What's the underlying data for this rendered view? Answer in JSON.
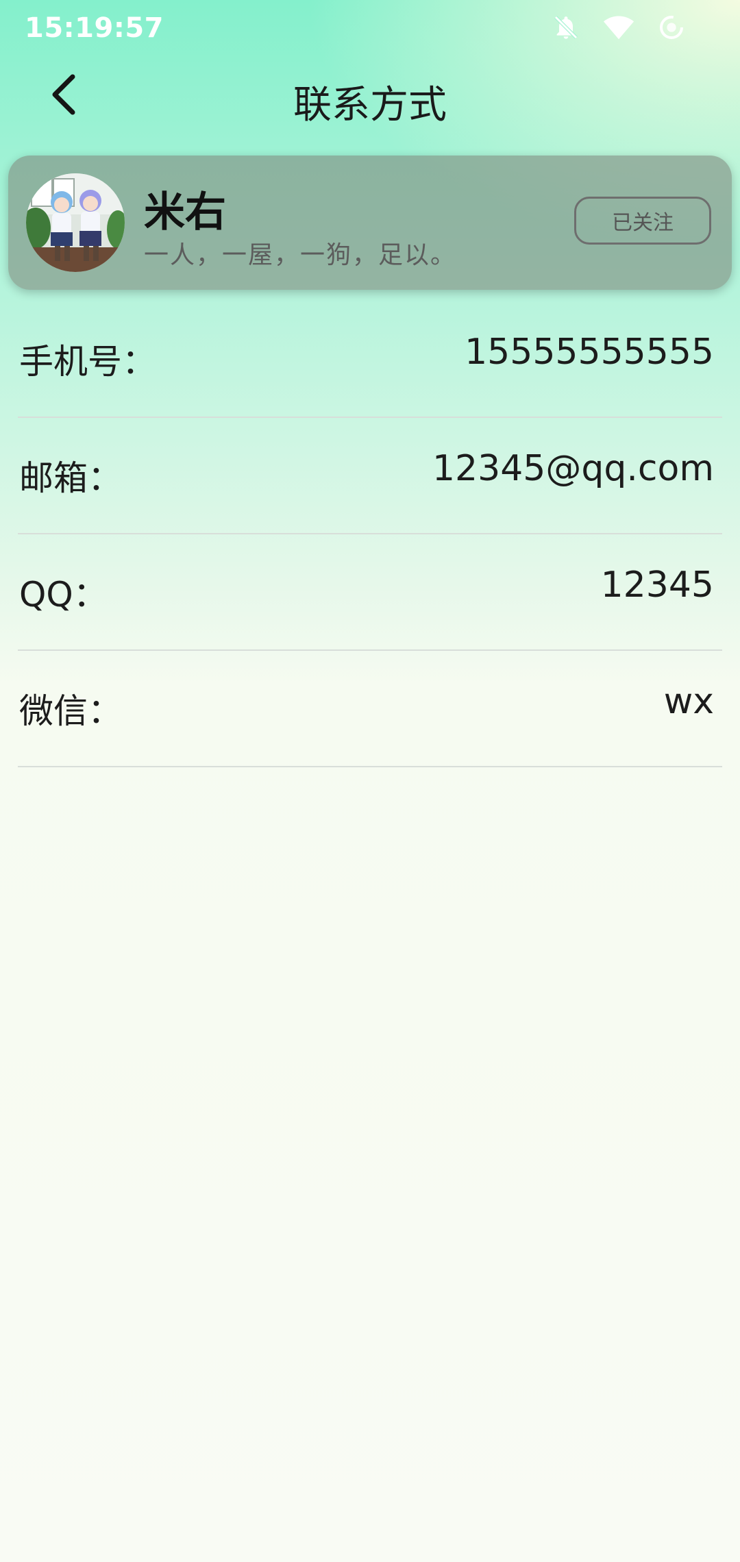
{
  "status_bar": {
    "time": "15:19:57",
    "icons": [
      "bell-off-icon",
      "wifi-icon",
      "data-saver-icon"
    ]
  },
  "header": {
    "title": "联系方式",
    "back_icon": "chevron-left-icon"
  },
  "profile": {
    "name": "米右",
    "bio": "一人，一屋，一狗，足以。",
    "follow_label": "已关注"
  },
  "contacts": [
    {
      "label": "手机号：",
      "value": "15555555555"
    },
    {
      "label": "邮箱：",
      "value": "12345@qq.com"
    },
    {
      "label": "QQ：",
      "value": "12345"
    },
    {
      "label": "微信：",
      "value": "wx"
    }
  ],
  "colors": {
    "gradient_top": "#84f0cc",
    "gradient_bottom": "#f9fbf4",
    "card_bg": "#808c80",
    "divider": "#d8ded9"
  }
}
